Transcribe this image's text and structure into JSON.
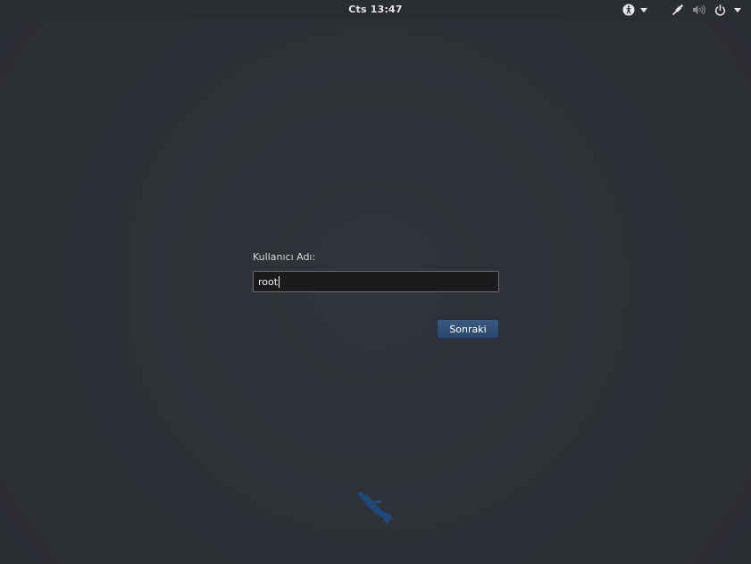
{
  "top_bar": {
    "clock": "Cts 13:47",
    "icons": {
      "accessibility": "accessibility-icon",
      "network": "wired-network-icon",
      "volume": "volume-icon",
      "power": "power-icon",
      "dropdown": "chevron-down-icon"
    }
  },
  "login": {
    "username_label": "Kullanıcı Adı:",
    "username_value": "root",
    "next_button": "Sonraki"
  },
  "logo": {
    "icon": "kali-dragon-logo"
  },
  "colors": {
    "background": "#2e3136",
    "button": "#2f4d74",
    "entry_bg": "#1a1b1d",
    "logo": "#1c3d66"
  }
}
